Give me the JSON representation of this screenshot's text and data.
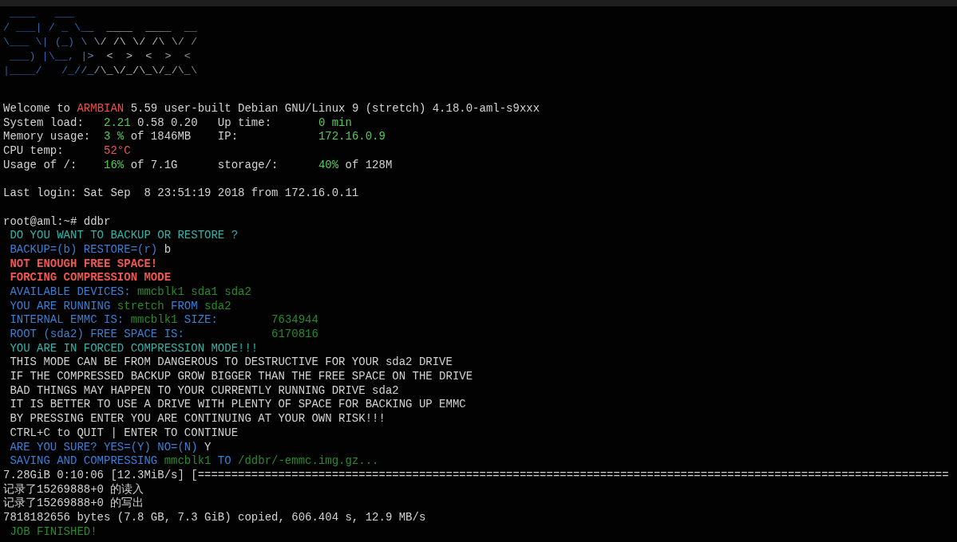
{
  "terminal": {
    "banner": [
      " ____   ___                   ",
      "/ ___| / _ \\__  ____  ____  __",
      "\\___ \\| (_) \\ \\/ /\\ \\/ /\\ \\/ /",
      " ___) |\\__, |>  <  >  <  >  < ",
      "|____/   /_//_/\\_\\/_/\\_\\/_/\\_\\"
    ],
    "blocks": [
      {
        "lines": [
          {
            "bold": false,
            "segments": [
              {
                "text": "Welcome to ",
                "color": "#d2d2d2"
              },
              {
                "text": "ARMBIAN",
                "color": "#e8514e"
              },
              {
                "text": " 5.59 user-built Debian GNU/Linux 9 (stretch) 4.18.0-aml-s9xxx",
                "color": "#d2d2d2"
              }
            ]
          },
          {
            "bold": false,
            "segments": [
              {
                "text": "System load:   ",
                "color": "#d2d2d2"
              },
              {
                "text": "2.21",
                "color": "#55cc55"
              },
              {
                "text": " 0.58 0.20   Up time:       ",
                "color": "#d2d2d2"
              },
              {
                "text": "0 min",
                "color": "#55cc55"
              }
            ]
          },
          {
            "bold": false,
            "segments": [
              {
                "text": "Memory usage:  ",
                "color": "#d2d2d2"
              },
              {
                "text": "3 %",
                "color": "#55cc55"
              },
              {
                "text": " of 1846MB    IP:            ",
                "color": "#d2d2d2"
              },
              {
                "text": "172.16.0.9",
                "color": "#55cc55"
              }
            ]
          },
          {
            "bold": false,
            "segments": [
              {
                "text": "CPU temp:      ",
                "color": "#d2d2d2"
              },
              {
                "text": "52°C",
                "color": "#e85a58"
              }
            ]
          },
          {
            "bold": false,
            "segments": [
              {
                "text": "Usage of /:    ",
                "color": "#d2d2d2"
              },
              {
                "text": "16%",
                "color": "#55cc55"
              },
              {
                "text": " of 7.1G      storage/:      ",
                "color": "#d2d2d2"
              },
              {
                "text": "40%",
                "color": "#55cc55"
              },
              {
                "text": " of 128M",
                "color": "#d2d2d2"
              }
            ]
          }
        ]
      },
      {
        "lines": [
          {
            "bold": false,
            "segments": [
              {
                "text": "Last login: Sat Sep  8 23:51:19 2018 from 172.16.0.11",
                "color": "#d2d2d2"
              }
            ]
          }
        ]
      },
      {
        "lines": [
          {
            "bold": false,
            "segments": [
              {
                "text": "root@aml:~# ddbr",
                "color": "#d2d2d2"
              }
            ]
          },
          {
            "bold": false,
            "segments": [
              {
                "text": " DO YOU WANT TO BACKUP OR RESTORE ?",
                "color": "#2fb5ab"
              }
            ]
          },
          {
            "bold": false,
            "segments": [
              {
                "text": " BACKUP=(b) RESTORE=(r) ",
                "color": "#3a7fd6"
              },
              {
                "text": "b",
                "color": "#d2d2d2"
              }
            ]
          },
          {
            "bold": true,
            "segments": [
              {
                "text": " NOT ENOUGH FREE SPACE!",
                "color": "#f25650"
              }
            ]
          },
          {
            "bold": true,
            "segments": [
              {
                "text": " FORCING COMPRESSION MODE",
                "color": "#f25650"
              }
            ]
          },
          {
            "bold": false,
            "segments": [
              {
                "text": " AVAILABLE DEVICES: ",
                "color": "#3a7fd6"
              },
              {
                "text": "mmcblk1 sda1 sda2",
                "color": "#2a8a2a"
              }
            ]
          },
          {
            "bold": false,
            "segments": [
              {
                "text": " YOU ARE RUNNING ",
                "color": "#3a7fd6"
              },
              {
                "text": "stretch",
                "color": "#2a8a2a"
              },
              {
                "text": " FROM ",
                "color": "#3a7fd6"
              },
              {
                "text": "sda2",
                "color": "#2a8a2a"
              }
            ]
          },
          {
            "bold": false,
            "segments": [
              {
                "text": " INTERNAL EMMC IS: ",
                "color": "#3a7fd6"
              },
              {
                "text": "mmcblk1",
                "color": "#2a8a2a"
              },
              {
                "text": " SIZE:        ",
                "color": "#3a7fd6"
              },
              {
                "text": "7634944",
                "color": "#2a8a2a"
              }
            ]
          },
          {
            "bold": false,
            "segments": [
              {
                "text": " ROOT (sda2) FREE SPACE IS:             ",
                "color": "#3a7fd6"
              },
              {
                "text": "6170816",
                "color": "#2a8a2a"
              }
            ]
          },
          {
            "bold": false,
            "segments": [
              {
                "text": " YOU ARE IN FORCED COMPRESSION MODE!!!",
                "color": "#2fb5ab"
              }
            ]
          },
          {
            "bold": false,
            "segments": [
              {
                "text": " THIS MODE CAN BE FROM DANGEROUS TO DESTRUCTIVE FOR YOUR sda2 DRIVE",
                "color": "#d2d2d2"
              }
            ]
          },
          {
            "bold": false,
            "segments": [
              {
                "text": " IF THE COMPRESSED BACKUP GROW BIGGER THAN THE FREE SPACE ON THE DRIVE",
                "color": "#d2d2d2"
              }
            ]
          },
          {
            "bold": false,
            "segments": [
              {
                "text": " BAD THINGS MAY HAPPEN TO YOUR CURRENTLY RUNNING DRIVE sda2",
                "color": "#d2d2d2"
              }
            ]
          },
          {
            "bold": false,
            "segments": [
              {
                "text": " IT IS BETTER TO USE A DRIVE WITH PLENTY OF SPACE FOR BACKING UP EMMC",
                "color": "#d2d2d2"
              }
            ]
          },
          {
            "bold": false,
            "segments": [
              {
                "text": " BY PRESSING ENTER YOU ARE CONTINUING AT YOUR OWN RISK!!!",
                "color": "#d2d2d2"
              }
            ]
          },
          {
            "bold": false,
            "segments": [
              {
                "text": " CTRL+C to QUIT | ENTER TO CONTINUE",
                "color": "#d2d2d2"
              }
            ]
          },
          {
            "bold": false,
            "segments": [
              {
                "text": " ARE YOU SURE? YES=(Y) NO=(N) ",
                "color": "#3a7fd6"
              },
              {
                "text": "Y",
                "color": "#d2d2d2"
              }
            ]
          },
          {
            "bold": false,
            "segments": [
              {
                "text": " SAVING AND COMPRESSING ",
                "color": "#3a7fd6"
              },
              {
                "text": "mmcblk1",
                "color": "#2a8a2a"
              },
              {
                "text": " TO ",
                "color": "#3a7fd6"
              },
              {
                "text": "/ddbr/-emmc.img.gz...",
                "color": "#2a8a2a"
              }
            ]
          },
          {
            "bold": false,
            "segments": [
              {
                "text": "7.28GiB 0:10:06 [12.3MiB/s] [================================================================================================================",
                "color": "#d2d2d2"
              }
            ]
          },
          {
            "bold": false,
            "segments": [
              {
                "text": "记录了15269888+0 的读入",
                "color": "#d2d2d2"
              }
            ]
          },
          {
            "bold": false,
            "segments": [
              {
                "text": "记录了15269888+0 的写出",
                "color": "#d2d2d2"
              }
            ]
          },
          {
            "bold": false,
            "segments": [
              {
                "text": "7818182656 bytes (7.8 GB, 7.3 GiB) copied, 606.404 s, 12.9 MB/s",
                "color": "#d2d2d2"
              }
            ]
          },
          {
            "bold": false,
            "segments": [
              {
                "text": " JOB FINISHED!",
                "color": "#2a8a2a"
              }
            ]
          }
        ]
      }
    ]
  }
}
